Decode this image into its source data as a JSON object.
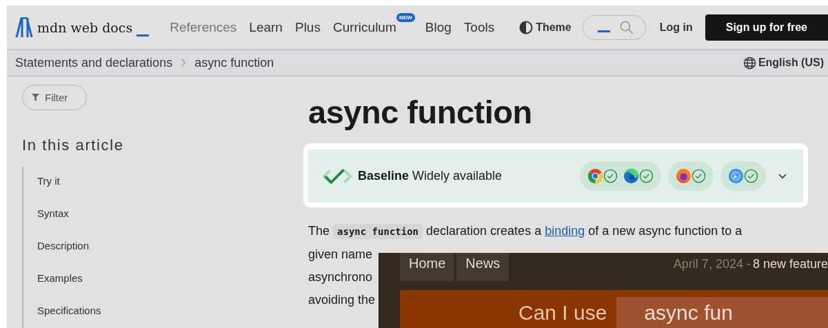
{
  "header": {
    "logo": "mdn web docs",
    "nav": [
      {
        "label": "References",
        "muted": true
      },
      {
        "label": "Learn",
        "muted": false
      },
      {
        "label": "Plus",
        "muted": false
      },
      {
        "label": "Curriculum",
        "muted": false,
        "badge": "NEW"
      },
      {
        "label": "Blog",
        "muted": false
      },
      {
        "label": "Tools",
        "muted": false
      }
    ],
    "theme": "Theme",
    "login": "Log in",
    "signup": "Sign up for free"
  },
  "breadcrumbs": [
    "Statements and declarations",
    "async function"
  ],
  "language": "English (US)",
  "sidebar": {
    "filter": "Filter",
    "toc_title": "In this article",
    "toc": [
      "Try it",
      "Syntax",
      "Description",
      "Examples",
      "Specifications"
    ]
  },
  "article": {
    "title": "async function",
    "baseline": {
      "label": "**Baseline** Widely available",
      "expanded": false,
      "groups": [
        [
          {
            "kind": "chrome",
            "supported": true
          },
          {
            "kind": "edge",
            "supported": true
          }
        ],
        [
          {
            "kind": "firefox",
            "supported": true
          }
        ],
        [
          {
            "kind": "safari",
            "supported": true
          }
        ]
      ]
    },
    "first_line": [
      {
        "kind": "text",
        "text": "The "
      },
      {
        "kind": "code",
        "text": "async function"
      },
      {
        "kind": "text",
        "text": " declaration creates a "
      },
      {
        "kind": "link",
        "text": "binding"
      },
      {
        "kind": "text",
        "text": " of a new async function to a"
      }
    ],
    "lines": [
      "given name",
      "asynchrono",
      "avoiding the"
    ]
  },
  "overlay": {
    "nav": [
      "Home",
      "News"
    ],
    "date": "April 7, 2024 - ",
    "headline": "8 new feature",
    "title": "Can I use",
    "query": "async fun"
  }
}
